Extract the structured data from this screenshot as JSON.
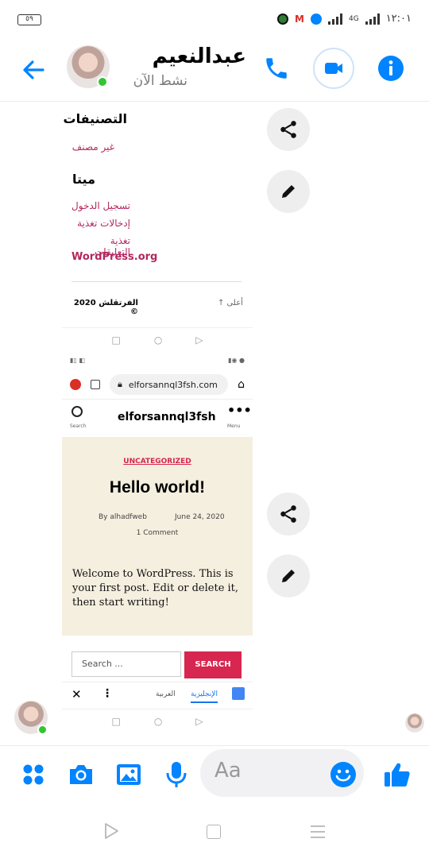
{
  "status_bar": {
    "battery": "٥٩",
    "time": "١٢:٠١",
    "network": "4G"
  },
  "header": {
    "contact_name": "عبدالنعيم",
    "contact_status": "نشط الآن"
  },
  "colors": {
    "accent": "#0084ff",
    "online": "#31c62f",
    "wp_link": "#b3275e",
    "wp_search_button": "#d7264f",
    "hello_card_bg": "#f5efe0"
  },
  "screenshot_top": {
    "categories_heading": "التصنيفات",
    "category_item": "غير مصنف",
    "meta_heading": "ميتا",
    "meta_links": [
      "تسجيل الدخول",
      "إدخالات تغذية",
      "تغذية التعليقات"
    ],
    "wp_org_link": "WordPress.org",
    "footer_copyright": "الفرتقلش 2020 ©",
    "footer_top_link": "أعلى ↑"
  },
  "screenshot_bottom": {
    "url": "elforsannql3fsh.com",
    "site_title": "elforsannql3fsh",
    "search_label": "Search",
    "menu_label": "Menu",
    "category_badge": "UNCATEGORIZED",
    "post_title": "Hello world!",
    "post_author": "By alhadfweb",
    "post_date": "June 24, 2020",
    "post_comments": "1 Comment",
    "post_body": "Welcome to WordPress. This is your first post. Edit or delete it, then start writing!",
    "search_placeholder": "Search ...",
    "search_button": "SEARCH",
    "translate_from": "الإنجليزية",
    "translate_to": "العربية"
  },
  "composer": {
    "placeholder": "Aa"
  }
}
